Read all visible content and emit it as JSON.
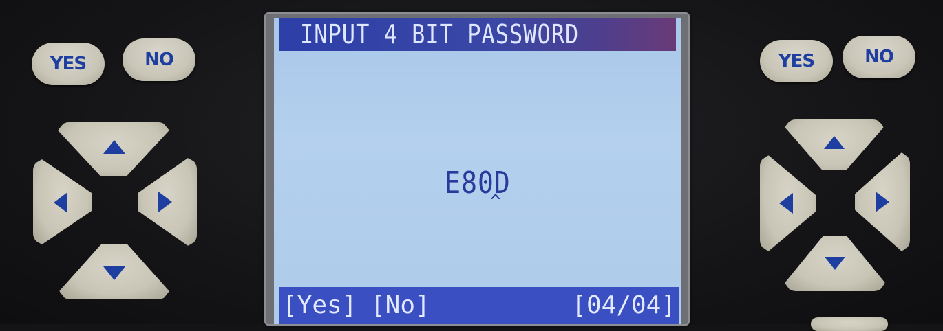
{
  "lcd": {
    "header": "INPUT 4 BIT PASSWORD",
    "password_value": "E80D",
    "cursor_mark": "^",
    "footer": {
      "yes_label": "[Yes]",
      "no_label": "[No]",
      "page_indicator": "[04/04]"
    }
  },
  "left_panel": {
    "yes_label": "YES",
    "no_label": "NO",
    "arrows": [
      "up-arrow-icon",
      "left-arrow-icon",
      "right-arrow-icon",
      "down-arrow-icon"
    ]
  },
  "right_panel": {
    "yes_label": "YES",
    "no_label": "NO",
    "arrows": [
      "up-arrow-icon",
      "left-arrow-icon",
      "right-arrow-icon",
      "down-arrow-icon"
    ]
  },
  "colors": {
    "lcd_background": "#aecbea",
    "lcd_header": "#3a47a5",
    "lcd_footer": "#3a4fc2",
    "lcd_text": "#2a3a9a",
    "button_face": "#c9c6b8",
    "button_text": "#1f3fa0",
    "arrow": "#1f3fa0"
  }
}
